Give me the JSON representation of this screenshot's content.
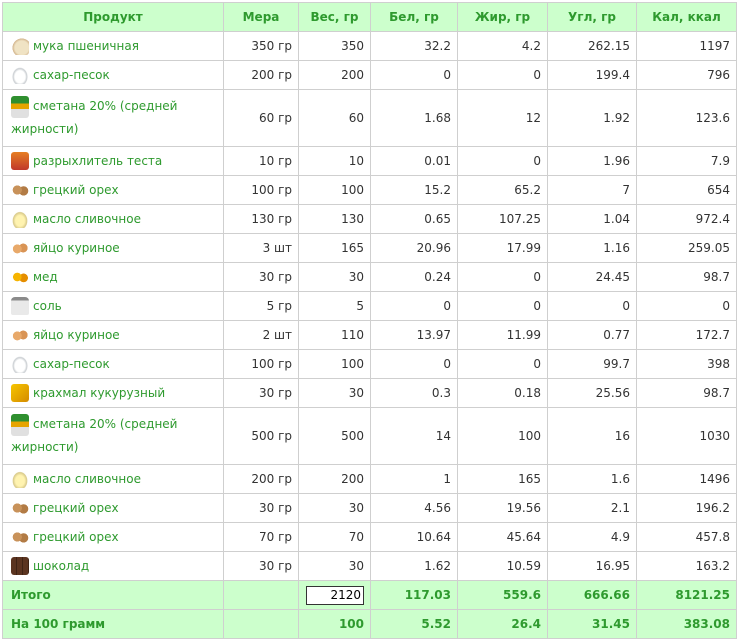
{
  "headers": [
    "Продукт",
    "Мера",
    "Вес, гр",
    "Бел, гр",
    "Жир, гр",
    "Угл, гр",
    "Кал, ккал"
  ],
  "rows": [
    {
      "icon": "flour-icon",
      "cls": "i-flour",
      "name": "мука пшеничная",
      "measure": "350 гр",
      "weight": "350",
      "protein": "32.2",
      "fat": "4.2",
      "carbs": "262.15",
      "kcal": "1197"
    },
    {
      "icon": "sugar-icon",
      "cls": "i-sugar",
      "name": "сахар-песок",
      "measure": "200 гр",
      "weight": "200",
      "protein": "0",
      "fat": "0",
      "carbs": "199.4",
      "kcal": "796"
    },
    {
      "icon": "sour-cream-icon",
      "cls": "i-cream",
      "tall": true,
      "name": "сметана 20% (средней жирности)",
      "measure": "60 гр",
      "weight": "60",
      "protein": "1.68",
      "fat": "12",
      "carbs": "1.92",
      "kcal": "123.6"
    },
    {
      "icon": "baking-powder-icon",
      "cls": "i-powder",
      "name": "разрыхлитель теста",
      "measure": "10 гр",
      "weight": "10",
      "protein": "0.01",
      "fat": "0",
      "carbs": "1.96",
      "kcal": "7.9"
    },
    {
      "icon": "walnut-icon",
      "cls": "i-walnut",
      "name": "грецкий орех",
      "measure": "100 гр",
      "weight": "100",
      "protein": "15.2",
      "fat": "65.2",
      "carbs": "7",
      "kcal": "654"
    },
    {
      "icon": "butter-icon",
      "cls": "i-butter",
      "name": "масло сливочное",
      "measure": "130 гр",
      "weight": "130",
      "protein": "0.65",
      "fat": "107.25",
      "carbs": "1.04",
      "kcal": "972.4"
    },
    {
      "icon": "egg-icon",
      "cls": "i-egg",
      "name": "яйцо куриное",
      "measure": "3 шт",
      "weight": "165",
      "protein": "20.96",
      "fat": "17.99",
      "carbs": "1.16",
      "kcal": "259.05"
    },
    {
      "icon": "honey-icon",
      "cls": "i-honey",
      "name": "мед",
      "measure": "30 гр",
      "weight": "30",
      "protein": "0.24",
      "fat": "0",
      "carbs": "24.45",
      "kcal": "98.7"
    },
    {
      "icon": "salt-icon",
      "cls": "i-salt",
      "name": "соль",
      "measure": "5 гр",
      "weight": "5",
      "protein": "0",
      "fat": "0",
      "carbs": "0",
      "kcal": "0"
    },
    {
      "icon": "egg-icon",
      "cls": "i-egg",
      "name": "яйцо куриное",
      "measure": "2 шт",
      "weight": "110",
      "protein": "13.97",
      "fat": "11.99",
      "carbs": "0.77",
      "kcal": "172.7"
    },
    {
      "icon": "sugar-icon",
      "cls": "i-sugar",
      "name": "сахар-песок",
      "measure": "100 гр",
      "weight": "100",
      "protein": "0",
      "fat": "0",
      "carbs": "99.7",
      "kcal": "398"
    },
    {
      "icon": "corn-starch-icon",
      "cls": "i-starch",
      "name": "крахмал кукурузный",
      "measure": "30 гр",
      "weight": "30",
      "protein": "0.3",
      "fat": "0.18",
      "carbs": "25.56",
      "kcal": "98.7"
    },
    {
      "icon": "sour-cream-icon",
      "cls": "i-cream",
      "tall": true,
      "name": "сметана 20% (средней жирности)",
      "measure": "500 гр",
      "weight": "500",
      "protein": "14",
      "fat": "100",
      "carbs": "16",
      "kcal": "1030"
    },
    {
      "icon": "butter-icon",
      "cls": "i-butter",
      "name": "масло сливочное",
      "measure": "200 гр",
      "weight": "200",
      "protein": "1",
      "fat": "165",
      "carbs": "1.6",
      "kcal": "1496"
    },
    {
      "icon": "walnut-icon",
      "cls": "i-walnut",
      "name": "грецкий орех",
      "measure": "30 гр",
      "weight": "30",
      "protein": "4.56",
      "fat": "19.56",
      "carbs": "2.1",
      "kcal": "196.2"
    },
    {
      "icon": "walnut-icon",
      "cls": "i-walnut",
      "name": "грецкий орех",
      "measure": "70 гр",
      "weight": "70",
      "protein": "10.64",
      "fat": "45.64",
      "carbs": "4.9",
      "kcal": "457.8"
    },
    {
      "icon": "chocolate-icon",
      "cls": "i-choc",
      "name": "шоколад",
      "measure": "30 гр",
      "weight": "30",
      "protein": "1.62",
      "fat": "10.59",
      "carbs": "16.95",
      "kcal": "163.2"
    }
  ],
  "total": {
    "label": "Итого",
    "weight": "2120",
    "protein": "117.03",
    "fat": "559.6",
    "carbs": "666.66",
    "kcal": "8121.25"
  },
  "per100": {
    "label": "На 100 грамм",
    "weight": "100",
    "protein": "5.52",
    "fat": "26.4",
    "carbs": "31.45",
    "kcal": "383.08"
  },
  "colors": {
    "header_bg": "#ccffcc",
    "accent": "#2e9a2e",
    "border": "#cfcfcf"
  }
}
